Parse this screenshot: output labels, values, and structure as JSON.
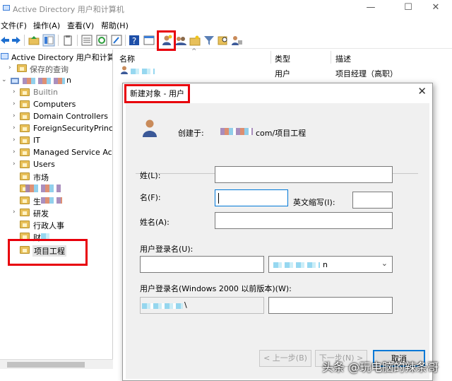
{
  "window": {
    "title": "Active Directory 用户和计算机",
    "minimize": "—",
    "maximize": "☐",
    "close": "✕"
  },
  "menu": [
    "文件(F)",
    "操作(A)",
    "查看(V)",
    "帮助(H)"
  ],
  "toolbar_icons": [
    "back-arrow-icon",
    "forward-arrow-icon",
    "folder-up-icon",
    "console-tree-icon",
    "clipboard-icon",
    "export-list-icon",
    "refresh-icon",
    "properties-icon",
    "help-icon",
    "console-icon",
    "new-user-icon",
    "new-group-icon",
    "new-ou-icon",
    "filter-icon",
    "find-icon",
    "delegate-icon"
  ],
  "tree": {
    "root": "Active Directory 用户和计算机",
    "saved_queries": "保存的查询",
    "domain_suffix": "n",
    "items": [
      "Builtin",
      "Computers",
      "Domain Controllers",
      "ForeignSecurityPrincipa",
      "IT",
      "Managed Service Acco",
      "Users",
      "市场",
      "",
      "生",
      "研发",
      "行政人事",
      "财",
      "项目工程"
    ]
  },
  "list": {
    "headers": [
      "名称",
      "类型",
      "描述"
    ],
    "row": {
      "type": "用户",
      "desc": "项目经理（高职）"
    }
  },
  "dialog": {
    "title": "新建对象 - 用户",
    "close": "✕",
    "created_in_label": "创建于:",
    "created_in_path": "com/项目工程",
    "surname_label": "姓(L):",
    "given_label": "名(F):",
    "initials_label": "英文缩写(I):",
    "fullname_label": "姓名(A):",
    "logon_label": "用户登录名(U):",
    "domain_value": "n",
    "pre2000_label": "用户登录名(Windows 2000 以前版本)(W):",
    "pre2000_prefix": "\\",
    "back_btn": "< 上一步(B)",
    "next_btn": "下一步(N) >",
    "cancel_btn": "取消"
  },
  "watermark": "头条 @玩电脑的辣条哥",
  "colors": {
    "highlight": "#e8000b",
    "focus": "#0078d7",
    "folder": "#e8c05a"
  }
}
